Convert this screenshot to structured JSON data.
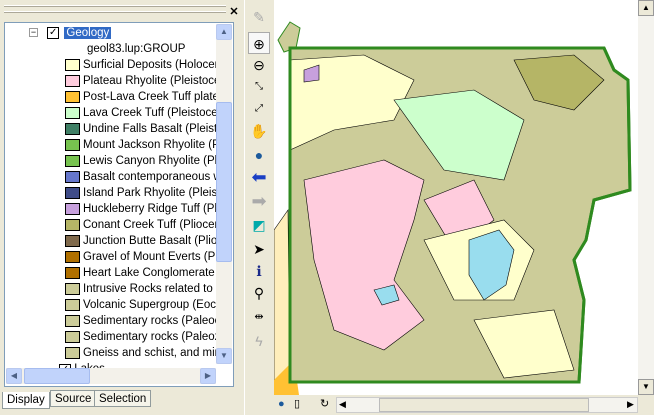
{
  "toc": {
    "layer": "Geology",
    "group": "geol83.lup:GROUP",
    "items": [
      {
        "label": "Surficial Deposits (Holocene",
        "color": "#ffffcc"
      },
      {
        "label": "Plateau Rhyolite (Pleistocen",
        "color": "#ffccdd"
      },
      {
        "label": "Post-Lava Creek Tuff platea",
        "color": "#ffc133"
      },
      {
        "label": "Lava Creek Tuff (Pleistocene",
        "color": "#ccffcc"
      },
      {
        "label": "Undine Falls Basalt (Pleistoc",
        "color": "#3f7f65"
      },
      {
        "label": "Mount Jackson Rhyolite (Ple",
        "color": "#77c34f"
      },
      {
        "label": "Lewis Canyon Rhyolite (Pleis",
        "color": "#77c34f"
      },
      {
        "label": "Basalt contemporaneous wit",
        "color": "#6677cc"
      },
      {
        "label": "Island Park Rhyolite (Pleisto",
        "color": "#3f4c88"
      },
      {
        "label": "Huckleberry Ridge Tuff (Plio",
        "color": "#c7a0dd"
      },
      {
        "label": "Conant Creek Tuff (Pliocene",
        "color": "#b5b566"
      },
      {
        "label": "Junction Butte Basalt (Plioce",
        "color": "#806a4c"
      },
      {
        "label": "Gravel of Mount Everts (Plio",
        "color": "#b07000"
      },
      {
        "label": "Heart Lake Conglomerate (F",
        "color": "#b07000"
      },
      {
        "label": "Intrusive Rocks related to th",
        "color": "#cccc99"
      },
      {
        "label": "Volcanic Supergroup (Eocen",
        "color": "#cccc99"
      },
      {
        "label": "Sedimentary rocks (Paleocer",
        "color": "#cccc99"
      },
      {
        "label": "Sedimentary rocks (Paleozoi",
        "color": "#cccc99"
      },
      {
        "label": "Gneiss and schist, and minor",
        "color": "#cccc99"
      }
    ],
    "next_layer": "Lakes",
    "tabs": [
      "Display",
      "Source",
      "Selection"
    ],
    "active_tab": "Display"
  },
  "tools": [
    "pin-icon",
    "zoom-in-icon",
    "zoom-out-icon",
    "fixed-zoom-in-icon",
    "fixed-zoom-out-icon",
    "pan-icon",
    "full-extent-icon",
    "back-icon",
    "forward-icon",
    "select-features-icon",
    "select-elements-icon",
    "identify-icon",
    "find-icon",
    "measure-icon",
    "hyperlink-icon"
  ],
  "map": {
    "boundary_color": "#2f8a1f",
    "lake_color": "#99ddee"
  }
}
